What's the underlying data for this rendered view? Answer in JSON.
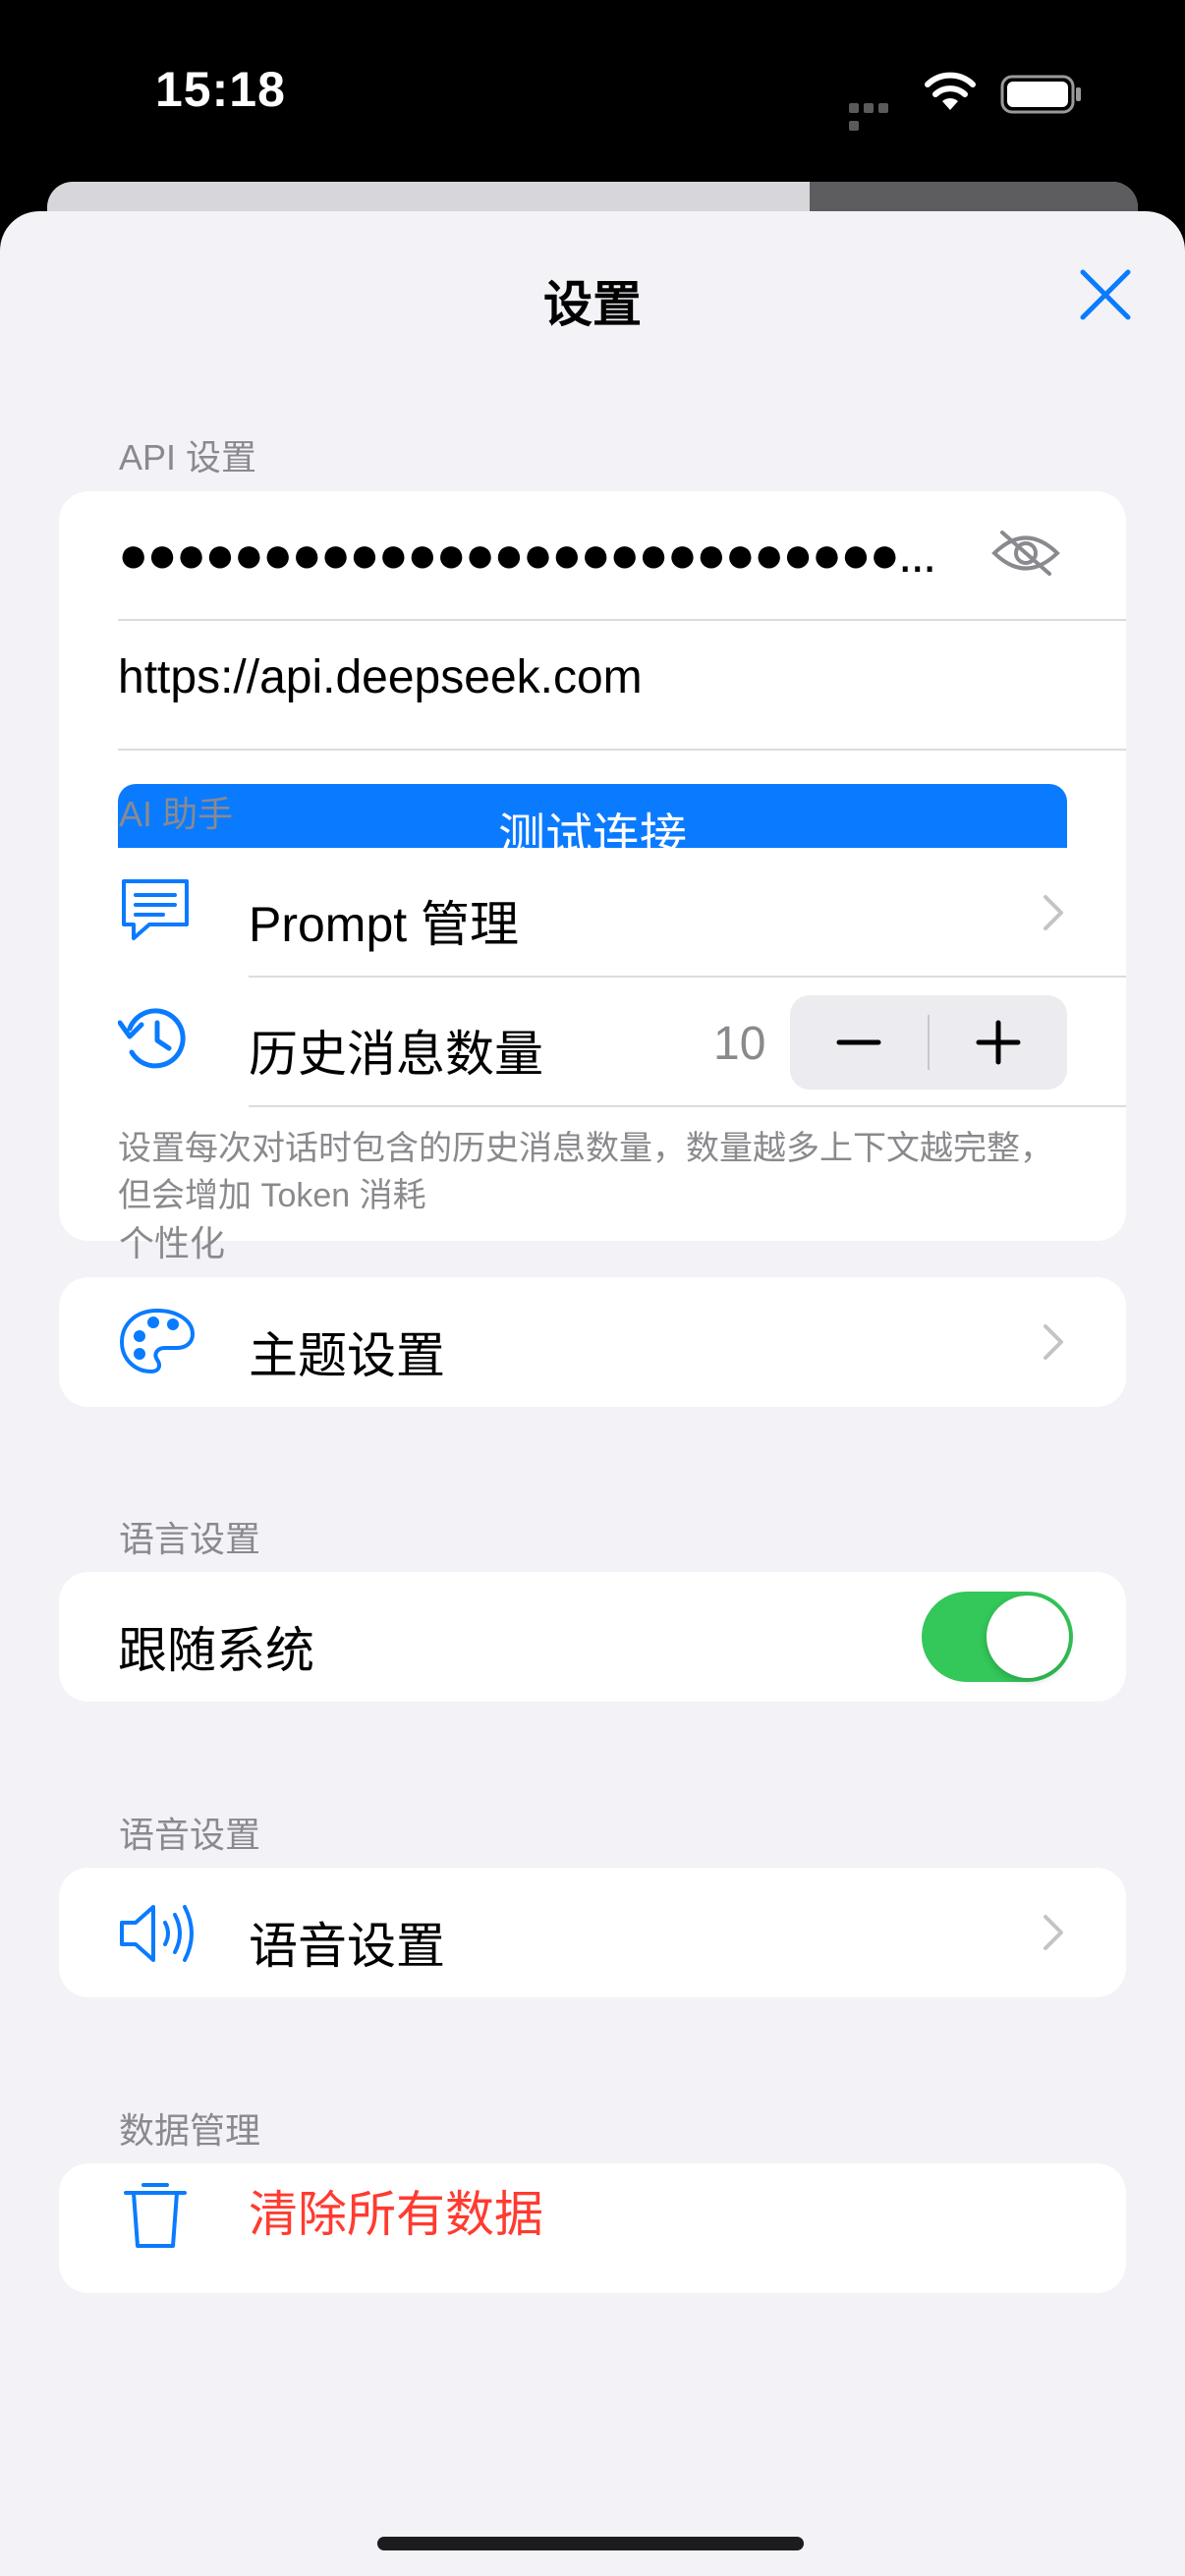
{
  "status_bar": {
    "time": "15:18"
  },
  "sheet": {
    "title": "设置",
    "close_icon": "close-icon"
  },
  "api_section": {
    "header": "API 设置",
    "api_key_masked": "●●●●●●●●●●●●●●●●●●●●●●●●●●●...",
    "base_url": "https://api.deepseek.com",
    "test_button": "测试连接"
  },
  "ai_section": {
    "header": "AI 助手",
    "prompt_label": "Prompt 管理",
    "history_label": "历史消息数量",
    "history_count": "10",
    "stepper_minus": "−",
    "stepper_plus": "+",
    "footnote": "设置每次对话时包含的历史消息数量，数量越多上下文越完整，但会增加 Token 消耗"
  },
  "personal_section": {
    "header": "个性化",
    "theme_label": "主题设置"
  },
  "language_section": {
    "header": "语言设置",
    "follow_system_label": "跟随系统",
    "follow_system_on": true
  },
  "voice_section": {
    "header": "语音设置",
    "voice_label": "语音设置"
  },
  "data_section": {
    "header": "数据管理",
    "clear_label": "清除所有数据"
  },
  "colors": {
    "accent": "#0a7bff",
    "toggle_on": "#34c759",
    "danger": "#ff3b30",
    "background": "#f2f2f7"
  }
}
